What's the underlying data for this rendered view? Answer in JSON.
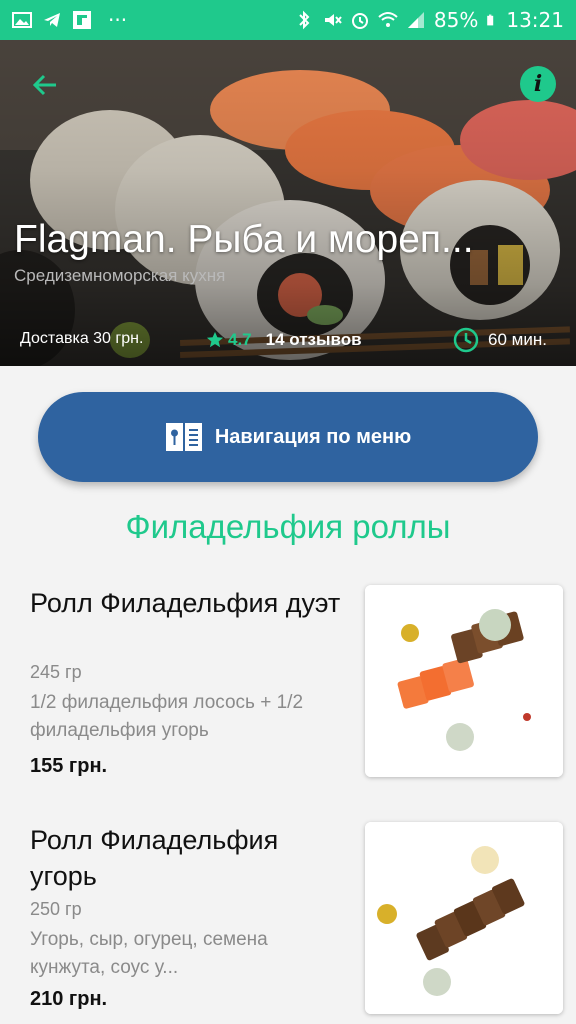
{
  "status_bar": {
    "battery": "85%",
    "time": "13:21",
    "dots": "···",
    "icons": [
      "gallery-icon",
      "telegram-icon",
      "flipboard-icon",
      "bluetooth-icon",
      "mute-icon",
      "alarm-icon",
      "wifi-icon",
      "signal-icon",
      "battery-icon"
    ]
  },
  "header": {
    "title": "Flagman. Рыба и мореп...",
    "subtitle": "Средиземноморская кухня",
    "delivery": "Доставка 30 грн.",
    "rating": "4.7",
    "reviews": "14 отзывов",
    "time": "60 мин.",
    "accent": "#1fc98c"
  },
  "nav_button": {
    "label": "Навигация по меню",
    "color": "#2f63a0"
  },
  "section": {
    "title": "Филадельфия роллы"
  },
  "items": [
    {
      "name": "Ролл Филадельфия дуэт",
      "weight": "245 гр",
      "description": "1/2 филадельфия лосось + 1/2 филадельфия угорь",
      "price": "155 грн."
    },
    {
      "name": "Ролл Филадельфия угорь",
      "weight": "250 гр",
      "description": "Угорь, сыр, огурец, семена кунжута, соус у...",
      "price": "210 грн."
    }
  ]
}
